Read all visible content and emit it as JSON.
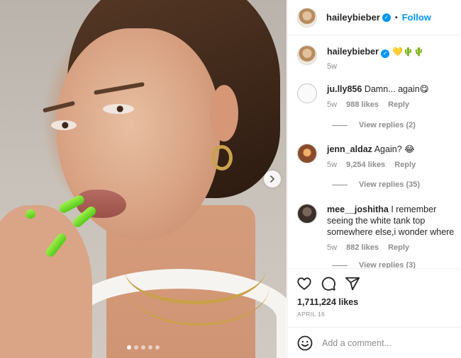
{
  "post": {
    "image_alt": "Photo by haileybieber",
    "carousel": {
      "total": 5,
      "current": 1
    }
  },
  "header": {
    "username": "haileybieber",
    "verified": true,
    "separator": "•",
    "follow_label": "Follow"
  },
  "caption": {
    "username": "haileybieber",
    "text": "💛🌵🌵",
    "time": "5w"
  },
  "comments": [
    {
      "username": "ju.lly856",
      "text": "Damn... again😋",
      "time": "5w",
      "likes": "988 likes",
      "reply_label": "Reply",
      "view_replies": "View replies (2)"
    },
    {
      "username": "jenn_aldaz",
      "text": "Again? 😂",
      "time": "5w",
      "likes": "9,254 likes",
      "reply_label": "Reply",
      "view_replies": "View replies (35)"
    },
    {
      "username": "mee__joshitha",
      "text": "I remember seeing the white tank top somewhere else,i wonder where",
      "time": "5w",
      "likes": "882 likes",
      "reply_label": "Reply",
      "view_replies": "View replies (3)"
    }
  ],
  "engagement": {
    "likes": "1,711,224 likes",
    "date": "APRIL 16"
  },
  "add_comment": {
    "placeholder": "Add a comment..."
  },
  "colors": {
    "accent": "#0095f6",
    "muted": "#8e8e8e",
    "nail_green": "#6bdc25"
  }
}
